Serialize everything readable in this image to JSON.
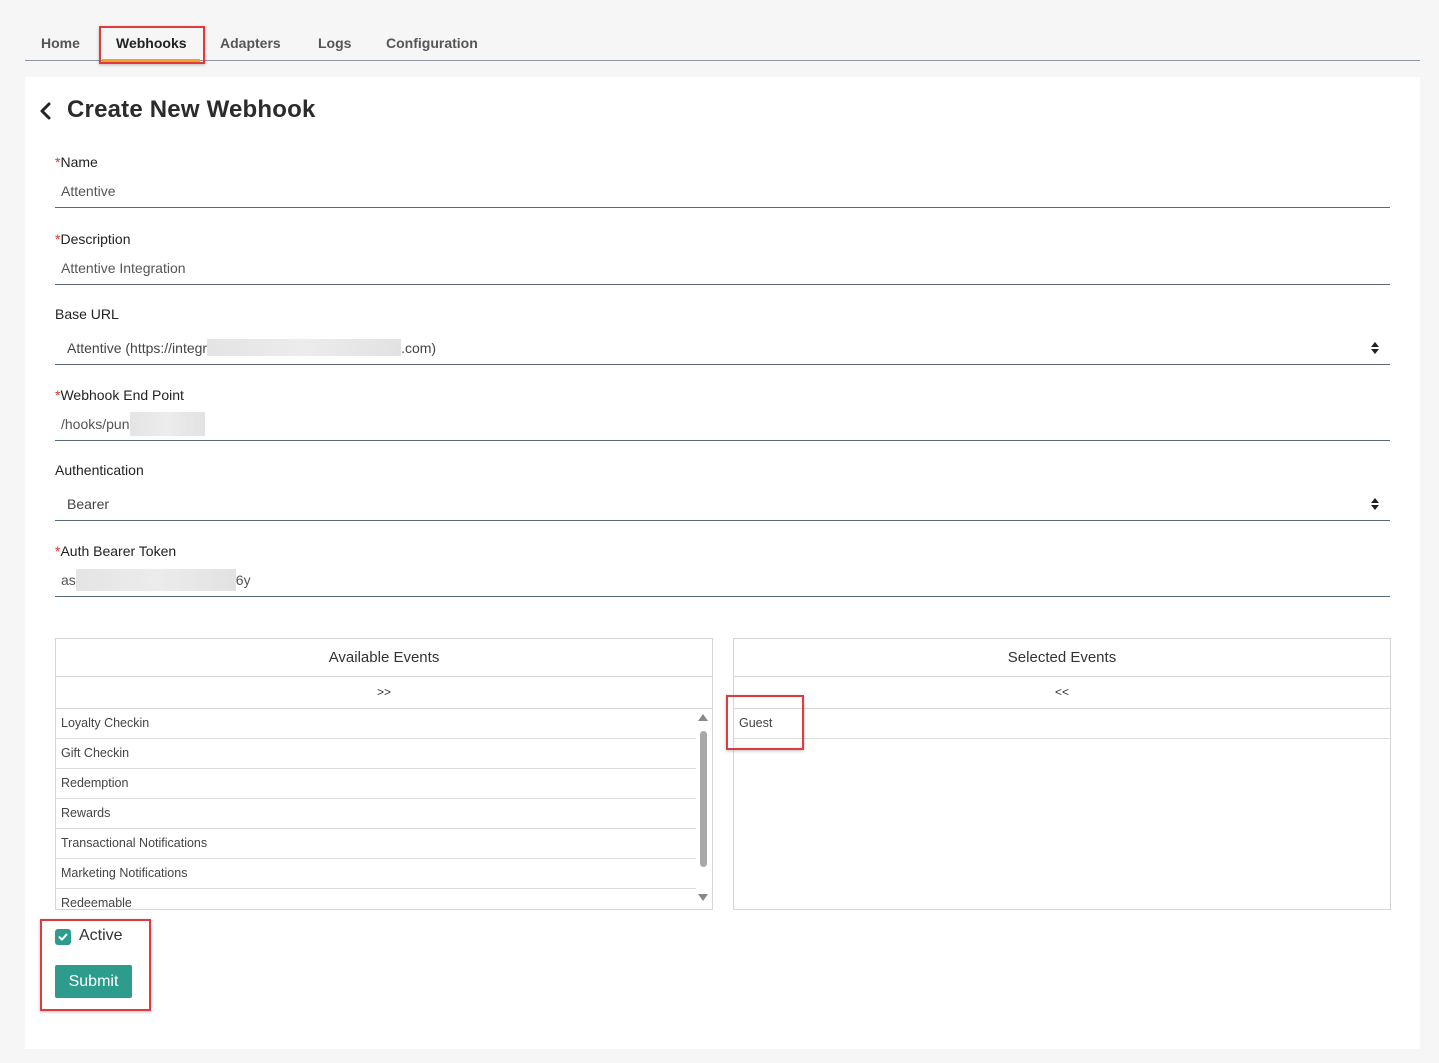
{
  "tabs": [
    "Home",
    "Webhooks",
    "Adapters",
    "Logs",
    "Configuration"
  ],
  "page": {
    "title": "Create New Webhook"
  },
  "form": {
    "required_mark": "*",
    "name": {
      "label": "Name",
      "value": "Attentive"
    },
    "description": {
      "label": "Description",
      "value": "Attentive Integration"
    },
    "base_url": {
      "label": "Base URL",
      "value_prefix": "Attentive (https://integr",
      "value_suffix": ".com)"
    },
    "endpoint": {
      "label": "Webhook End Point",
      "value_prefix": "/hooks/pun"
    },
    "authentication": {
      "label": "Authentication",
      "value": "Bearer"
    },
    "token": {
      "label": "Auth Bearer Token",
      "value_prefix": "as",
      "value_suffix": "6y"
    }
  },
  "available_events": {
    "title": "Available Events",
    "move_label": ">>",
    "items": [
      "Loyalty Checkin",
      "Gift Checkin",
      "Redemption",
      "Rewards",
      "Transactional Notifications",
      "Marketing Notifications",
      "Redeemable"
    ]
  },
  "selected_events": {
    "title": "Selected Events",
    "move_label": "<<",
    "items": [
      "Guest"
    ]
  },
  "active": {
    "label": "Active",
    "checked": true
  },
  "submit_label": "Submit",
  "colors": {
    "accent": "#2e9c8c",
    "tab_underline": "#f0a32a",
    "highlight": "#e0393e",
    "required": "#d9342b"
  }
}
